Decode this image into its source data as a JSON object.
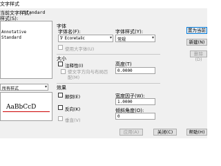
{
  "window": {
    "title": "文字样式"
  },
  "current_style": {
    "label": "当前文字样式：",
    "value": "Standard"
  },
  "styles_list": {
    "label": "样式(S):",
    "items": [
      "Annotative",
      "Standard"
    ]
  },
  "list_filter": {
    "value": "所有样式"
  },
  "preview": {
    "text": "AaBbCcD"
  },
  "font": {
    "group_label": "字体",
    "name_label": "字体名(F):",
    "name_value": "Ꮴ Ecoretalic",
    "style_label": "字体样式(Y):",
    "style_value": "常规",
    "bigfont_label": "使用大字体(U)"
  },
  "size": {
    "group_label": "大小",
    "annotative_label": "注释性(I)",
    "match_orientation_label": "使文字方向与布局匹配(M)",
    "height_label": "高度(T)",
    "height_value": "0.0000"
  },
  "effects": {
    "group_label": "效果",
    "upside_down_label": "颠倒(E)",
    "backwards_label": "反向(K)",
    "vertical_label": "垂直(V)",
    "width_factor_label": "宽度因子(W):",
    "width_factor_value": "1.0000",
    "oblique_label": "倾斜角度(O):",
    "oblique_value": "0"
  },
  "buttons": {
    "set_current": "置为当前",
    "new": "新建(N)",
    "delete": "删除(D)",
    "apply": "应用(A)",
    "close": "关闭(C)",
    "help": "帮助(H)"
  }
}
